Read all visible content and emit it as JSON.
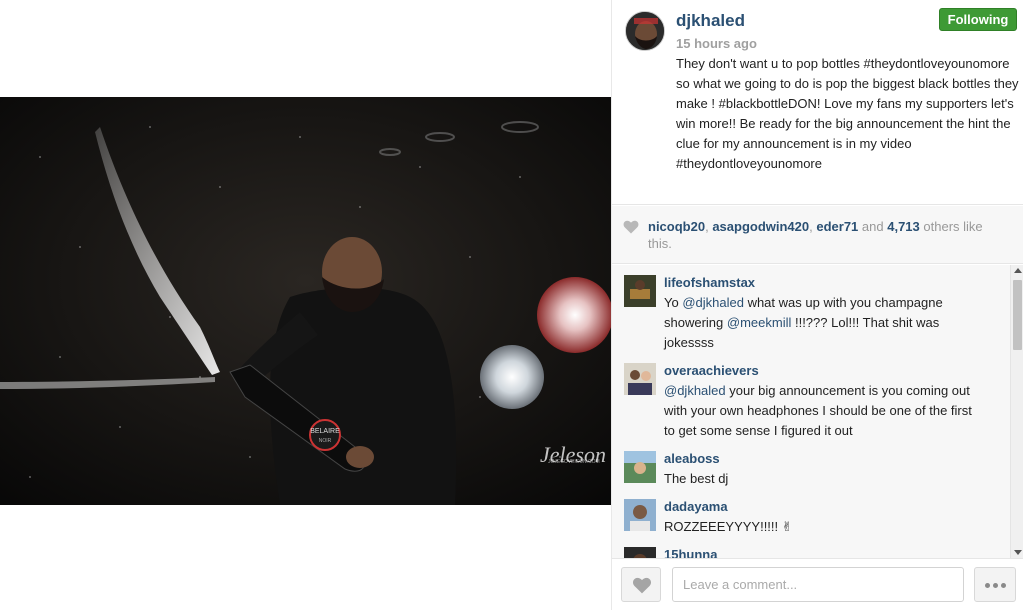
{
  "post": {
    "username": "djkhaled",
    "timestamp": "15 hours ago",
    "follow_label": "Following",
    "caption": "They don't want u to pop bottles #theydontloveyounomore so what we going to do is pop the biggest black bottles they make ! #blackbottleDON! Love my fans my supporters let's win more!! Be ready for the big announcement the hint the clue for my announcement is in my video #theydontloveyounomore"
  },
  "likes": {
    "user1": "nicoqb20",
    "user2": "asapgodwin420",
    "user3": "eder71",
    "and": "and",
    "count": "4,713",
    "suffix": "others like this."
  },
  "comments": [
    {
      "username": "lifeofshamstax",
      "parts": [
        "Yo ",
        "@djkhaled",
        " what was up with you champagne showering ",
        "@meekmill",
        " !!!??? Lol!!! That shit was jokessss"
      ]
    },
    {
      "username": "overaachievers",
      "parts": [
        "@djkhaled",
        " your big announcement is you coming out with your own headphones I should be one of the first to get some sense I figured it out"
      ]
    },
    {
      "username": "aleaboss",
      "text": "The best dj"
    },
    {
      "username": "dadayama",
      "text": "ROZZEEEYYYY!!!!! ✌"
    },
    {
      "username": "15hunna",
      "text": ""
    }
  ],
  "footer": {
    "comment_placeholder": "Leave a comment..."
  },
  "photo": {
    "watermark": "Jeleson",
    "watermark_small": "JOJECOVEISON.COM",
    "bottle_label_top": "BELAIRE",
    "bottle_label_bottom": "NOIR"
  },
  "colors": {
    "link": "#2b5073",
    "follow_green": "#3e9a35",
    "muted": "#a0a0a0"
  },
  "icons": {
    "like": "heart-icon",
    "more": "ellipsis-icon",
    "scroll_up": "arrow-up-icon",
    "scroll_down": "arrow-down-icon"
  }
}
